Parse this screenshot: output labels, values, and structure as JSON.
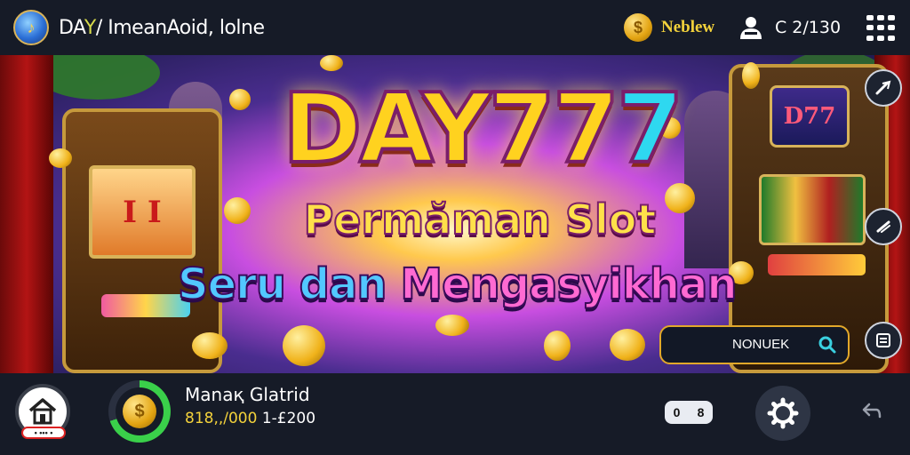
{
  "topbar": {
    "logo_glyph": "♪",
    "app_title_part1": "DA",
    "app_title_accent": "Y",
    "app_title_part2": "/ ImeanAoid, lolne",
    "balance_label": "Neblew",
    "counter": "C  2/130"
  },
  "banner": {
    "title_main": "DAY77",
    "title_last": "7",
    "subtitle_line1": "Permăman Slot",
    "subtitle_line2_a": "Seru dan ",
    "subtitle_line2_b": "Mengasyikhan",
    "left_machine_screen": "I I",
    "right_machine_marquee": "D77",
    "search_pill_text": "NONUEK"
  },
  "bottombar": {
    "home_badge": "• ••• •",
    "coin_glyph": "$",
    "player_name": "Manaқ Glatrid",
    "player_stats_a": "818,,/000",
    "player_stats_b": " 1-£200",
    "toggle_left": "0",
    "toggle_right": "8"
  },
  "colors": {
    "accent_gold": "#f3d23b",
    "bar_bg": "#161b27",
    "title_blue": "#2ed8f0",
    "title_pink": "#ff6ad2"
  },
  "icons": [
    "logo-icon",
    "coin-icon",
    "user-icon",
    "menu-grid-icon",
    "pen-icon",
    "slash-icon",
    "list-icon",
    "search-icon",
    "home-icon",
    "settings-gear-icon",
    "back-arrow-icon"
  ]
}
